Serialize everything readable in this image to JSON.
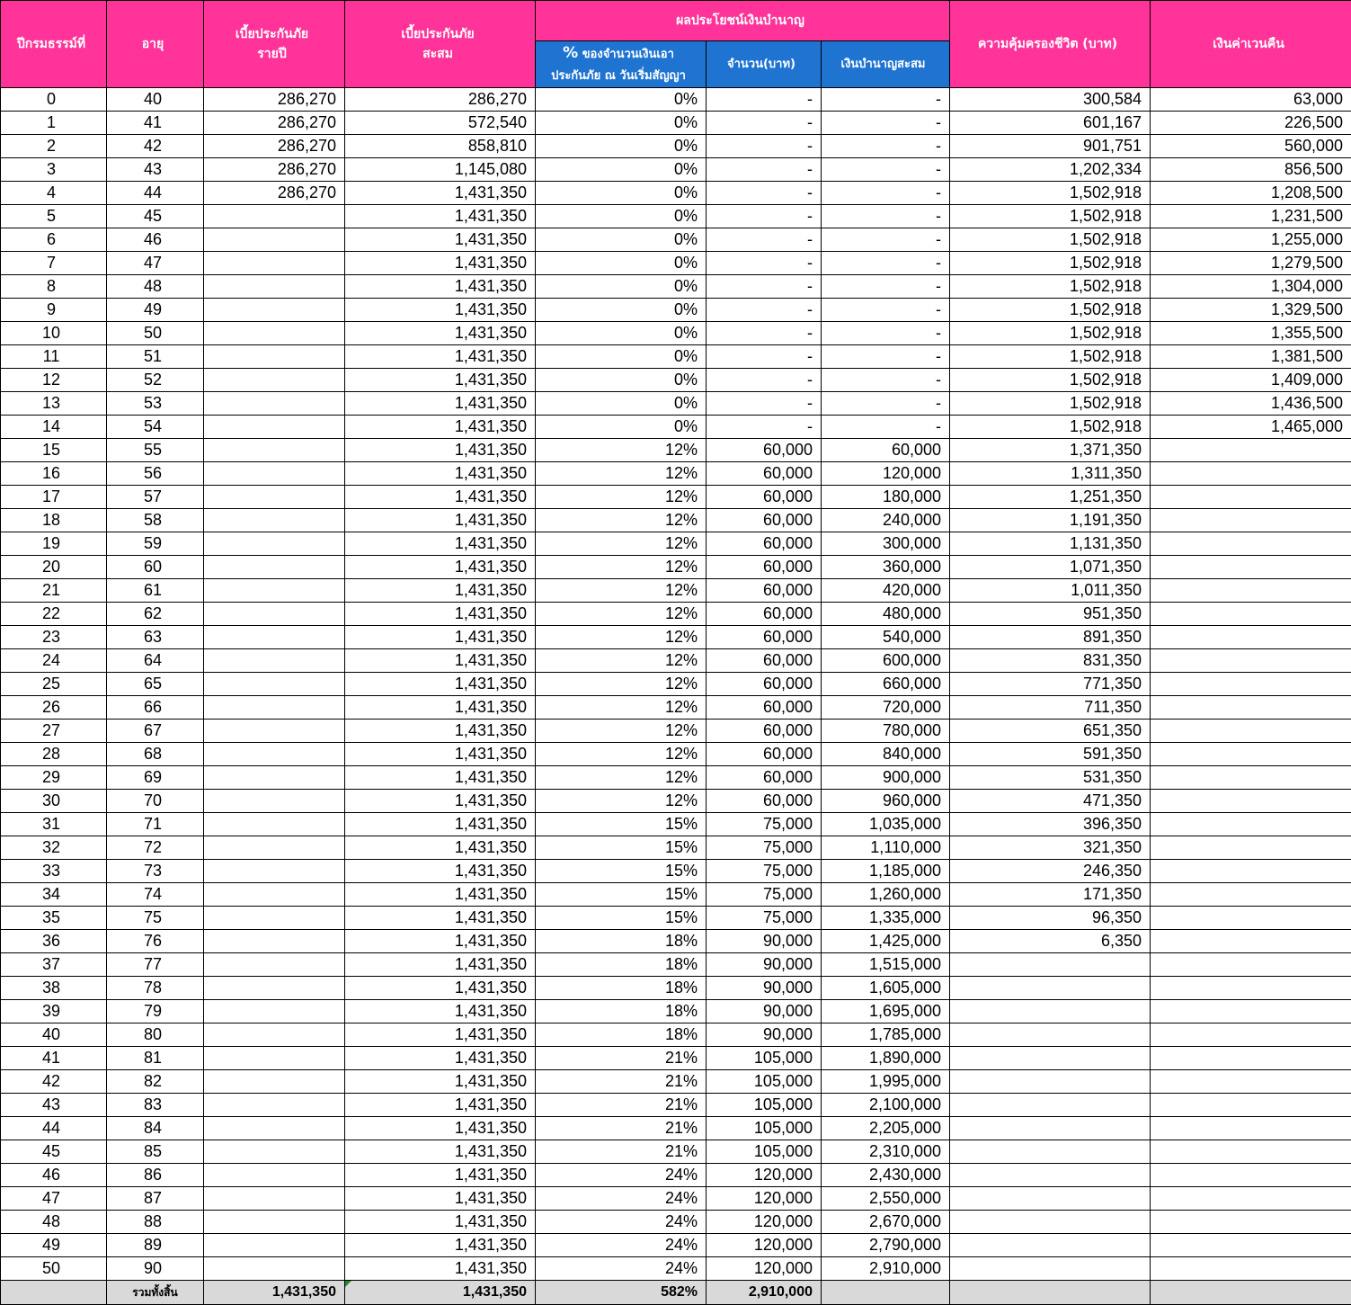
{
  "headers": {
    "policy_year": "ปีกรมธรรม์ที่",
    "age": "อายุ",
    "annual_premium_line1": "เบี้ยประกันภัย",
    "annual_premium_line2": "รายปี",
    "cumulative_premium_line1": "เบี้ยประกันภัย",
    "cumulative_premium_line2": "สะสม",
    "pension_group": "ผลประโยชน์เงินบำนาญ",
    "pension_pct_symbol": "%",
    "pension_pct_line1": " ของจำนวนเงินเอา",
    "pension_pct_line2": "ประกันภัย ณ วันเริ่มสัญญา",
    "pension_amount": "จำนวน(บาท)",
    "pension_cumulative": "เงินบำนาญสะสม",
    "life_coverage": "ความคุ้มครองชีวิต (บาท)",
    "surrender_value": "เงินค่าเวนคืน"
  },
  "rows": [
    {
      "year": "0",
      "age": "40",
      "annual": "286,270",
      "cum": "286,270",
      "pct": "0%",
      "amount": "-",
      "pcum": "-",
      "cover": "300,584",
      "surrender": "63,000"
    },
    {
      "year": "1",
      "age": "41",
      "annual": "286,270",
      "cum": "572,540",
      "pct": "0%",
      "amount": "-",
      "pcum": "-",
      "cover": "601,167",
      "surrender": "226,500"
    },
    {
      "year": "2",
      "age": "42",
      "annual": "286,270",
      "cum": "858,810",
      "pct": "0%",
      "amount": "-",
      "pcum": "-",
      "cover": "901,751",
      "surrender": "560,000"
    },
    {
      "year": "3",
      "age": "43",
      "annual": "286,270",
      "cum": "1,145,080",
      "pct": "0%",
      "amount": "-",
      "pcum": "-",
      "cover": "1,202,334",
      "surrender": "856,500"
    },
    {
      "year": "4",
      "age": "44",
      "annual": "286,270",
      "cum": "1,431,350",
      "pct": "0%",
      "amount": "-",
      "pcum": "-",
      "cover": "1,502,918",
      "surrender": "1,208,500"
    },
    {
      "year": "5",
      "age": "45",
      "annual": "",
      "cum": "1,431,350",
      "pct": "0%",
      "amount": "-",
      "pcum": "-",
      "cover": "1,502,918",
      "surrender": "1,231,500"
    },
    {
      "year": "6",
      "age": "46",
      "annual": "",
      "cum": "1,431,350",
      "pct": "0%",
      "amount": "-",
      "pcum": "-",
      "cover": "1,502,918",
      "surrender": "1,255,000"
    },
    {
      "year": "7",
      "age": "47",
      "annual": "",
      "cum": "1,431,350",
      "pct": "0%",
      "amount": "-",
      "pcum": "-",
      "cover": "1,502,918",
      "surrender": "1,279,500"
    },
    {
      "year": "8",
      "age": "48",
      "annual": "",
      "cum": "1,431,350",
      "pct": "0%",
      "amount": "-",
      "pcum": "-",
      "cover": "1,502,918",
      "surrender": "1,304,000"
    },
    {
      "year": "9",
      "age": "49",
      "annual": "",
      "cum": "1,431,350",
      "pct": "0%",
      "amount": "-",
      "pcum": "-",
      "cover": "1,502,918",
      "surrender": "1,329,500"
    },
    {
      "year": "10",
      "age": "50",
      "annual": "",
      "cum": "1,431,350",
      "pct": "0%",
      "amount": "-",
      "pcum": "-",
      "cover": "1,502,918",
      "surrender": "1,355,500"
    },
    {
      "year": "11",
      "age": "51",
      "annual": "",
      "cum": "1,431,350",
      "pct": "0%",
      "amount": "-",
      "pcum": "-",
      "cover": "1,502,918",
      "surrender": "1,381,500"
    },
    {
      "year": "12",
      "age": "52",
      "annual": "",
      "cum": "1,431,350",
      "pct": "0%",
      "amount": "-",
      "pcum": "-",
      "cover": "1,502,918",
      "surrender": "1,409,000"
    },
    {
      "year": "13",
      "age": "53",
      "annual": "",
      "cum": "1,431,350",
      "pct": "0%",
      "amount": "-",
      "pcum": "-",
      "cover": "1,502,918",
      "surrender": "1,436,500"
    },
    {
      "year": "14",
      "age": "54",
      "annual": "",
      "cum": "1,431,350",
      "pct": "0%",
      "amount": "-",
      "pcum": "-",
      "cover": "1,502,918",
      "surrender": "1,465,000"
    },
    {
      "year": "15",
      "age": "55",
      "annual": "",
      "cum": "1,431,350",
      "pct": "12%",
      "amount": "60,000",
      "pcum": "60,000",
      "cover": "1,371,350",
      "surrender": ""
    },
    {
      "year": "16",
      "age": "56",
      "annual": "",
      "cum": "1,431,350",
      "pct": "12%",
      "amount": "60,000",
      "pcum": "120,000",
      "cover": "1,311,350",
      "surrender": ""
    },
    {
      "year": "17",
      "age": "57",
      "annual": "",
      "cum": "1,431,350",
      "pct": "12%",
      "amount": "60,000",
      "pcum": "180,000",
      "cover": "1,251,350",
      "surrender": ""
    },
    {
      "year": "18",
      "age": "58",
      "annual": "",
      "cum": "1,431,350",
      "pct": "12%",
      "amount": "60,000",
      "pcum": "240,000",
      "cover": "1,191,350",
      "surrender": ""
    },
    {
      "year": "19",
      "age": "59",
      "annual": "",
      "cum": "1,431,350",
      "pct": "12%",
      "amount": "60,000",
      "pcum": "300,000",
      "cover": "1,131,350",
      "surrender": ""
    },
    {
      "year": "20",
      "age": "60",
      "annual": "",
      "cum": "1,431,350",
      "pct": "12%",
      "amount": "60,000",
      "pcum": "360,000",
      "cover": "1,071,350",
      "surrender": ""
    },
    {
      "year": "21",
      "age": "61",
      "annual": "",
      "cum": "1,431,350",
      "pct": "12%",
      "amount": "60,000",
      "pcum": "420,000",
      "cover": "1,011,350",
      "surrender": ""
    },
    {
      "year": "22",
      "age": "62",
      "annual": "",
      "cum": "1,431,350",
      "pct": "12%",
      "amount": "60,000",
      "pcum": "480,000",
      "cover": "951,350",
      "surrender": ""
    },
    {
      "year": "23",
      "age": "63",
      "annual": "",
      "cum": "1,431,350",
      "pct": "12%",
      "amount": "60,000",
      "pcum": "540,000",
      "cover": "891,350",
      "surrender": ""
    },
    {
      "year": "24",
      "age": "64",
      "annual": "",
      "cum": "1,431,350",
      "pct": "12%",
      "amount": "60,000",
      "pcum": "600,000",
      "cover": "831,350",
      "surrender": ""
    },
    {
      "year": "25",
      "age": "65",
      "annual": "",
      "cum": "1,431,350",
      "pct": "12%",
      "amount": "60,000",
      "pcum": "660,000",
      "cover": "771,350",
      "surrender": ""
    },
    {
      "year": "26",
      "age": "66",
      "annual": "",
      "cum": "1,431,350",
      "pct": "12%",
      "amount": "60,000",
      "pcum": "720,000",
      "cover": "711,350",
      "surrender": ""
    },
    {
      "year": "27",
      "age": "67",
      "annual": "",
      "cum": "1,431,350",
      "pct": "12%",
      "amount": "60,000",
      "pcum": "780,000",
      "cover": "651,350",
      "surrender": ""
    },
    {
      "year": "28",
      "age": "68",
      "annual": "",
      "cum": "1,431,350",
      "pct": "12%",
      "amount": "60,000",
      "pcum": "840,000",
      "cover": "591,350",
      "surrender": ""
    },
    {
      "year": "29",
      "age": "69",
      "annual": "",
      "cum": "1,431,350",
      "pct": "12%",
      "amount": "60,000",
      "pcum": "900,000",
      "cover": "531,350",
      "surrender": ""
    },
    {
      "year": "30",
      "age": "70",
      "annual": "",
      "cum": "1,431,350",
      "pct": "12%",
      "amount": "60,000",
      "pcum": "960,000",
      "cover": "471,350",
      "surrender": ""
    },
    {
      "year": "31",
      "age": "71",
      "annual": "",
      "cum": "1,431,350",
      "pct": "15%",
      "amount": "75,000",
      "pcum": "1,035,000",
      "cover": "396,350",
      "surrender": ""
    },
    {
      "year": "32",
      "age": "72",
      "annual": "",
      "cum": "1,431,350",
      "pct": "15%",
      "amount": "75,000",
      "pcum": "1,110,000",
      "cover": "321,350",
      "surrender": ""
    },
    {
      "year": "33",
      "age": "73",
      "annual": "",
      "cum": "1,431,350",
      "pct": "15%",
      "amount": "75,000",
      "pcum": "1,185,000",
      "cover": "246,350",
      "surrender": ""
    },
    {
      "year": "34",
      "age": "74",
      "annual": "",
      "cum": "1,431,350",
      "pct": "15%",
      "amount": "75,000",
      "pcum": "1,260,000",
      "cover": "171,350",
      "surrender": ""
    },
    {
      "year": "35",
      "age": "75",
      "annual": "",
      "cum": "1,431,350",
      "pct": "15%",
      "amount": "75,000",
      "pcum": "1,335,000",
      "cover": "96,350",
      "surrender": ""
    },
    {
      "year": "36",
      "age": "76",
      "annual": "",
      "cum": "1,431,350",
      "pct": "18%",
      "amount": "90,000",
      "pcum": "1,425,000",
      "cover": "6,350",
      "surrender": ""
    },
    {
      "year": "37",
      "age": "77",
      "annual": "",
      "cum": "1,431,350",
      "pct": "18%",
      "amount": "90,000",
      "pcum": "1,515,000",
      "cover": "",
      "surrender": ""
    },
    {
      "year": "38",
      "age": "78",
      "annual": "",
      "cum": "1,431,350",
      "pct": "18%",
      "amount": "90,000",
      "pcum": "1,605,000",
      "cover": "",
      "surrender": ""
    },
    {
      "year": "39",
      "age": "79",
      "annual": "",
      "cum": "1,431,350",
      "pct": "18%",
      "amount": "90,000",
      "pcum": "1,695,000",
      "cover": "",
      "surrender": ""
    },
    {
      "year": "40",
      "age": "80",
      "annual": "",
      "cum": "1,431,350",
      "pct": "18%",
      "amount": "90,000",
      "pcum": "1,785,000",
      "cover": "",
      "surrender": ""
    },
    {
      "year": "41",
      "age": "81",
      "annual": "",
      "cum": "1,431,350",
      "pct": "21%",
      "amount": "105,000",
      "pcum": "1,890,000",
      "cover": "",
      "surrender": ""
    },
    {
      "year": "42",
      "age": "82",
      "annual": "",
      "cum": "1,431,350",
      "pct": "21%",
      "amount": "105,000",
      "pcum": "1,995,000",
      "cover": "",
      "surrender": ""
    },
    {
      "year": "43",
      "age": "83",
      "annual": "",
      "cum": "1,431,350",
      "pct": "21%",
      "amount": "105,000",
      "pcum": "2,100,000",
      "cover": "",
      "surrender": ""
    },
    {
      "year": "44",
      "age": "84",
      "annual": "",
      "cum": "1,431,350",
      "pct": "21%",
      "amount": "105,000",
      "pcum": "2,205,000",
      "cover": "",
      "surrender": ""
    },
    {
      "year": "45",
      "age": "85",
      "annual": "",
      "cum": "1,431,350",
      "pct": "21%",
      "amount": "105,000",
      "pcum": "2,310,000",
      "cover": "",
      "surrender": ""
    },
    {
      "year": "46",
      "age": "86",
      "annual": "",
      "cum": "1,431,350",
      "pct": "24%",
      "amount": "120,000",
      "pcum": "2,430,000",
      "cover": "",
      "surrender": ""
    },
    {
      "year": "47",
      "age": "87",
      "annual": "",
      "cum": "1,431,350",
      "pct": "24%",
      "amount": "120,000",
      "pcum": "2,550,000",
      "cover": "",
      "surrender": ""
    },
    {
      "year": "48",
      "age": "88",
      "annual": "",
      "cum": "1,431,350",
      "pct": "24%",
      "amount": "120,000",
      "pcum": "2,670,000",
      "cover": "",
      "surrender": ""
    },
    {
      "year": "49",
      "age": "89",
      "annual": "",
      "cum": "1,431,350",
      "pct": "24%",
      "amount": "120,000",
      "pcum": "2,790,000",
      "cover": "",
      "surrender": ""
    },
    {
      "year": "50",
      "age": "90",
      "annual": "",
      "cum": "1,431,350",
      "pct": "24%",
      "amount": "120,000",
      "pcum": "2,910,000",
      "cover": "",
      "surrender": ""
    }
  ],
  "totals": {
    "label": "รวมทั้งสิ้น",
    "annual": "1,431,350",
    "cum": "1,431,350",
    "pct": "582%",
    "amount": "2,910,000"
  },
  "colors": {
    "header_pink": "#FF3399",
    "header_blue": "#1F74D2",
    "total_row_bg": "#D9D9D9",
    "cell_flag": "#1E8B2E"
  }
}
